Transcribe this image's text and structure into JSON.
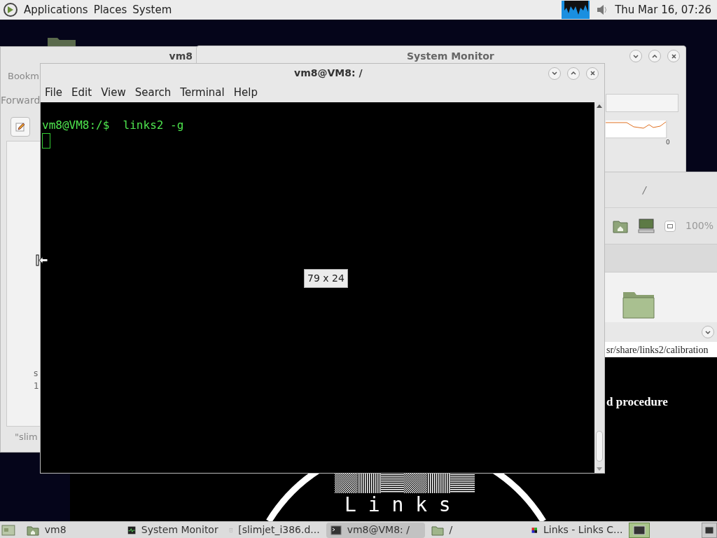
{
  "top_panel": {
    "menus": [
      "Applications",
      "Places",
      "System"
    ],
    "clock": "Thu Mar 16, 07:26"
  },
  "file_window": {
    "title": "vm8",
    "bookmarks": "Bookm",
    "forward": "Forward",
    "lines": [
      "s",
      "1"
    ],
    "status": "\"slim"
  },
  "monitor_window": {
    "title": "System Monitor",
    "axis_label": "0"
  },
  "folder_window": {
    "title": "/",
    "zoom": "100%"
  },
  "links_window": {
    "address": "sr/share/links2/calibration",
    "text": "d procedure",
    "logo": "L i n k s"
  },
  "terminal_window": {
    "title": "vm8@VM8: /",
    "menus": [
      "File",
      "Edit",
      "View",
      "Search",
      "Terminal",
      "Help"
    ],
    "line": "vm8@VM8:/$  links2 -g",
    "size_tip": "79 x 24"
  },
  "taskbar": {
    "items": [
      {
        "kind": "folder",
        "label": "vm8",
        "selected": false
      },
      {
        "kind": "monitor",
        "label": "System Monitor",
        "selected": false
      },
      {
        "kind": "document",
        "label": "[slimjet_i386.d...",
        "selected": false
      },
      {
        "kind": "terminal",
        "label": "vm8@VM8: /",
        "selected": true
      },
      {
        "kind": "plainfolder",
        "label": "/",
        "selected": false
      },
      {
        "kind": "links",
        "label": "Links - Links C...",
        "selected": false
      }
    ]
  }
}
